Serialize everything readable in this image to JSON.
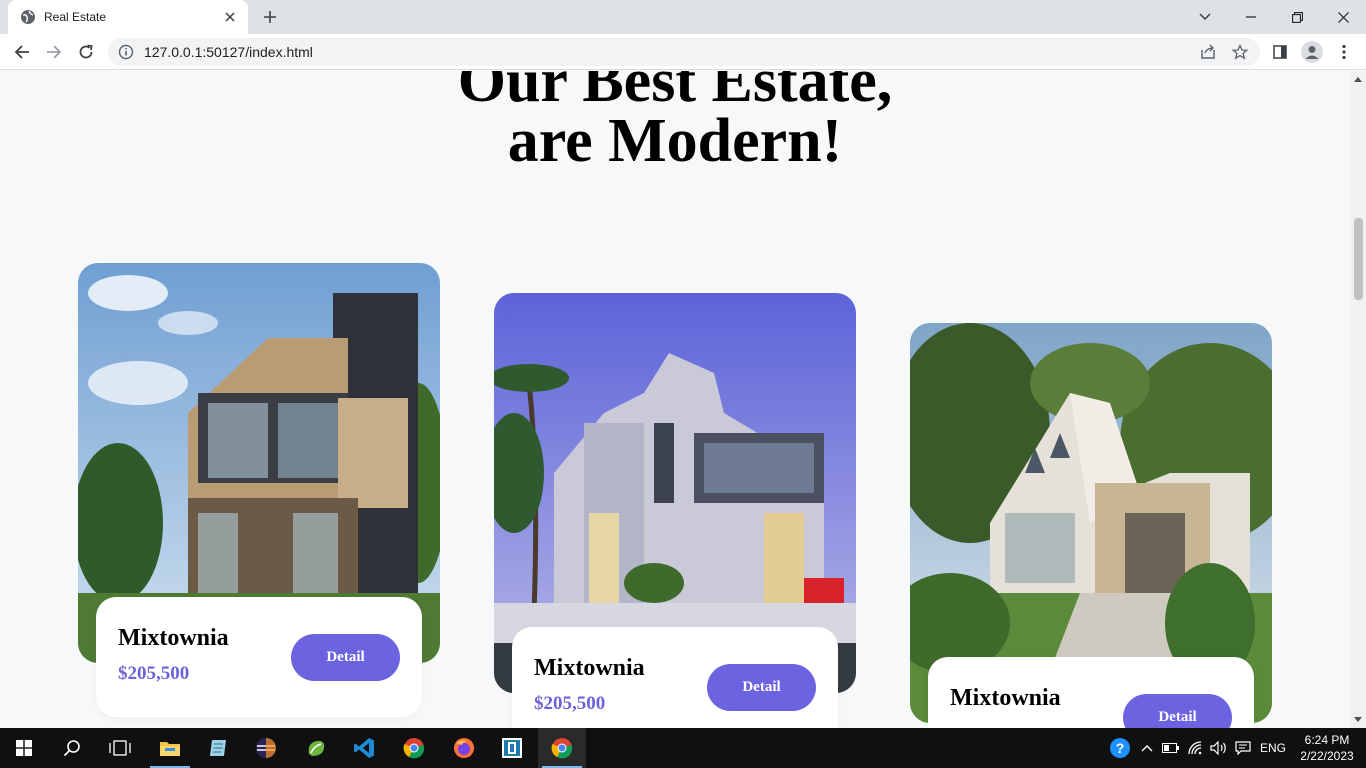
{
  "browser": {
    "tab_title": "Real Estate",
    "url": "127.0.0.1:50127/index.html"
  },
  "page": {
    "heading_line1": "Our Best Estate,",
    "heading_line2": "are Modern!",
    "cards": [
      {
        "name": "Mixtownia",
        "price": "$205,500",
        "button": "Detail"
      },
      {
        "name": "Mixtownia",
        "price": "$205,500",
        "button": "Detail"
      },
      {
        "name": "Mixtownia",
        "button": "Detail"
      }
    ]
  },
  "colors": {
    "accent": "#6c63e0",
    "price": "#6c63d9",
    "page_bg": "#f7f8fa"
  },
  "taskbar": {
    "apps": [
      "windows-start-icon",
      "search-icon",
      "task-view-icon",
      "file-explorer-icon",
      "notepad-icon",
      "eclipse-icon",
      "spring-tool-icon",
      "vscode-icon",
      "chrome-icon",
      "firefox-icon",
      "app-icon",
      "chrome-icon"
    ],
    "language": "ENG",
    "time": "6:24 PM",
    "date": "2/22/2023"
  }
}
